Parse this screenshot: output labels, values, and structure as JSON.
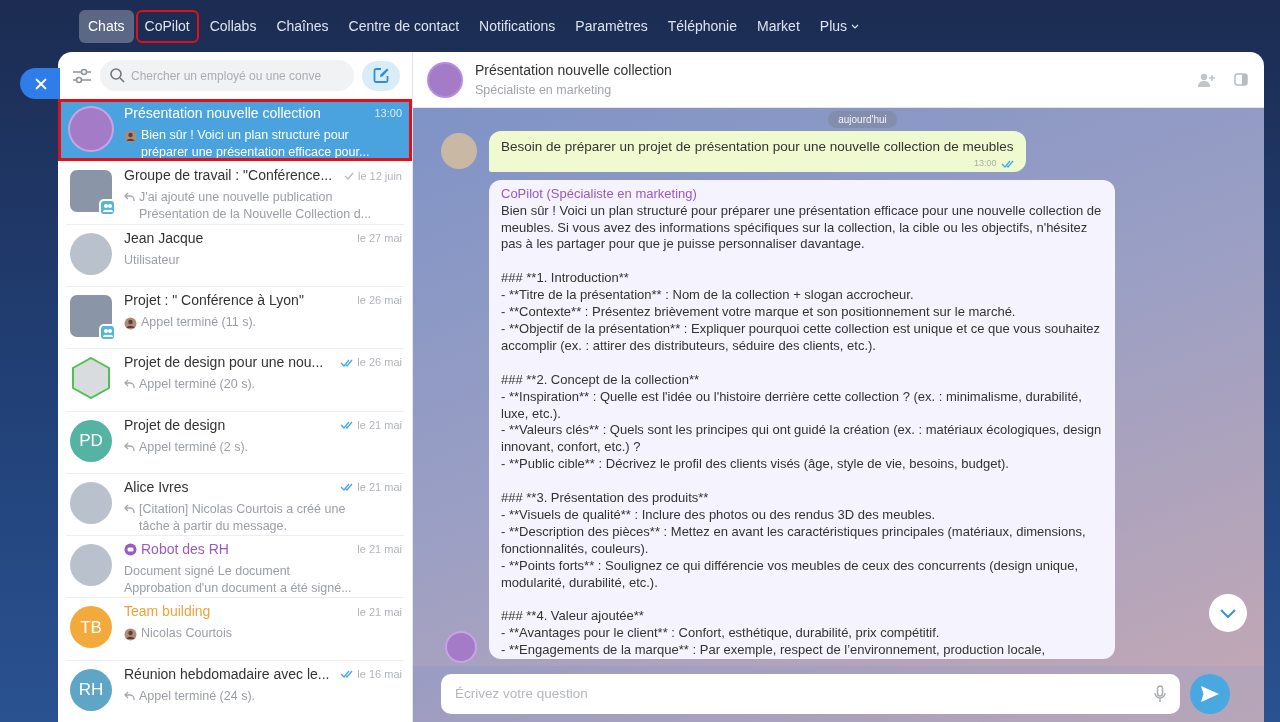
{
  "nav": {
    "items": [
      {
        "label": "Chats",
        "selected": true
      },
      {
        "label": "CoPilot",
        "selected": false,
        "highlighted": true
      },
      {
        "label": "Collabs",
        "selected": false
      },
      {
        "label": "Chaînes",
        "selected": false
      },
      {
        "label": "Centre de contact",
        "selected": false
      },
      {
        "label": "Notifications",
        "selected": false
      },
      {
        "label": "Paramètres",
        "selected": false
      },
      {
        "label": "Téléphonie",
        "selected": false
      },
      {
        "label": "Market",
        "selected": false
      }
    ],
    "more": "Plus"
  },
  "search": {
    "placeholder": "Chercher un employé ou une conve"
  },
  "chats": [
    {
      "kind": "round",
      "title": "Présentation nouvelle collection",
      "time": "13:00",
      "sender_avatar": true,
      "preview": [
        "Bien sûr ! Voici un plan structuré pour",
        "préparer une présentation efficace pour..."
      ],
      "selected": true,
      "highlighted": true
    },
    {
      "kind": "square",
      "title": "Groupe de travail : \"Conférence...",
      "time": "le 12 juin",
      "sent": true,
      "reply": true,
      "preview": [
        "J'ai ajouté une nouvelle publication",
        "Présentation de la Nouvelle Collection d..."
      ],
      "group": true,
      "selected": false
    },
    {
      "kind": "round",
      "title": "Jean Jacque",
      "time": "le 27 mai",
      "preview": [
        "Utilisateur"
      ],
      "selected": false
    },
    {
      "kind": "square",
      "title": "Projet : \" Conférence à Lyon\"",
      "time": "le 26 mai",
      "sender_avatar": true,
      "preview": [
        "Appel terminé (11 s)."
      ],
      "group": true,
      "selected": false
    },
    {
      "kind": "hexagon",
      "title": "Projet de design pour une nou...",
      "time": "le 26 mai",
      "sent": true,
      "read": true,
      "reply": true,
      "preview": [
        "Appel terminé (20 s)."
      ],
      "selected": false
    },
    {
      "kind": "initials",
      "avatar": {
        "initials": "PD",
        "color": "#55b3a4"
      },
      "title": "Projet de design",
      "time": "le 21 mai",
      "sent": true,
      "read": true,
      "reply": true,
      "preview": [
        "Appel terminé (2 s)."
      ],
      "selected": false
    },
    {
      "kind": "round",
      "title": "Alice Ivres",
      "time": "le 21 mai",
      "sent": true,
      "read": true,
      "reply": true,
      "preview": [
        "[Citation] Nicolas Courtois a créé une",
        "tâche à partir du message."
      ],
      "selected": false
    },
    {
      "kind": "round",
      "title": "Robot des RH",
      "color": "#9b59c4",
      "time": "le 21 mai",
      "preview": [
        "Document signé Le document",
        "Approbation d'un document a été signé..."
      ],
      "bot": true,
      "selected": false
    },
    {
      "kind": "initials",
      "avatar": {
        "initials": "TB",
        "color": "#f3aa3c"
      },
      "title": "Team building",
      "color": "#eea23a",
      "time": "le 21 mai",
      "sender_avatar": true,
      "preview": [
        "Nicolas Courtois"
      ],
      "selected": false
    },
    {
      "kind": "initials",
      "avatar": {
        "initials": "RH",
        "color": "#5ea5c6"
      },
      "title": "Réunion hebdomadaire avec le...",
      "time": "le 16 mai",
      "sent": true,
      "read": true,
      "reply": true,
      "preview": [
        "Appel terminé (24 s)."
      ],
      "selected": false
    }
  ],
  "header": {
    "title": "Présentation nouvelle collection",
    "subtitle": "Spécialiste en marketing"
  },
  "date_badge": "aujourd'hui",
  "user_message": {
    "text": "Besoin de préparer un projet de présentation pour une nouvelle collection de meubles",
    "time": "13:00",
    "read": true
  },
  "bot_message": {
    "author": "CoPilot (Spécialiste en marketing)",
    "blocks": [
      [
        "Bien sûr ! Voici un plan structuré pour préparer une présentation efficace pour une nouvelle collection de meubles. Si vous avez des informations spécifiques sur la collection, la cible ou les objectifs, n'hésitez pas à les partager pour que je puisse personnaliser davantage."
      ],
      [
        "### **1. Introduction**",
        "- **Titre de la présentation** : Nom de la collection + slogan accrocheur.",
        "- **Contexte** : Présentez brièvement votre marque et son positionnement sur le marché.",
        "- **Objectif de la présentation** : Expliquer pourquoi cette collection est unique et ce que vous souhaitez accomplir (ex. : attirer des distributeurs, séduire des clients, etc.)."
      ],
      [
        "### **2. Concept de la collection**",
        "- **Inspiration** : Quelle est l'idée ou l'histoire derrière cette collection ? (ex. : minimalisme, durabilité, luxe, etc.).",
        "- **Valeurs clés** : Quels sont les principes qui ont guidé la création (ex. : matériaux écologiques, design innovant, confort, etc.) ?",
        "- **Public cible** : Décrivez le profil des clients visés (âge, style de vie, besoins, budget)."
      ],
      [
        "### **3. Présentation des produits**",
        "- **Visuels de qualité** : Inclure des photos ou des rendus 3D des meubles.",
        "- **Description des pièces** : Mettez en avant les caractéristiques principales (matériaux, dimensions, fonctionnalités, couleurs).",
        "- **Points forts** : Soulignez ce qui différencie vos meubles de ceux des concurrents (design unique, modularité, durabilité, etc.)."
      ],
      [
        "### **4. Valeur ajoutée**",
        "- **Avantages pour le client** : Confort, esthétique, durabilité, prix compétitif.",
        "- **Engagements de la marque** : Par exemple, respect de l’environnement, production locale,"
      ]
    ]
  },
  "composer": {
    "placeholder": "Écrivez votre question"
  }
}
